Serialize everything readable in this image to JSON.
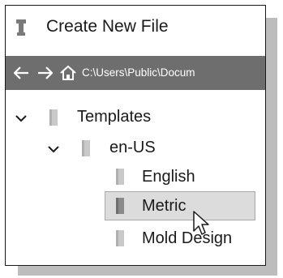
{
  "window": {
    "title": "Create New File"
  },
  "navbar": {
    "path": "C:\\Users\\Public\\Docum"
  },
  "tree": {
    "root": {
      "label": "Templates",
      "expanded": true
    },
    "locale": {
      "label": "en-US",
      "expanded": true
    },
    "items": [
      {
        "label": "English",
        "selected": false
      },
      {
        "label": "Metric",
        "selected": true
      },
      {
        "label": "Mold Design",
        "selected": false
      }
    ]
  },
  "colors": {
    "navbar_bg": "#6e6e6e",
    "selection_bg": "#dcdcdc",
    "folder_light": "#c9c9c9",
    "folder_dark": "#8a8a8a"
  }
}
